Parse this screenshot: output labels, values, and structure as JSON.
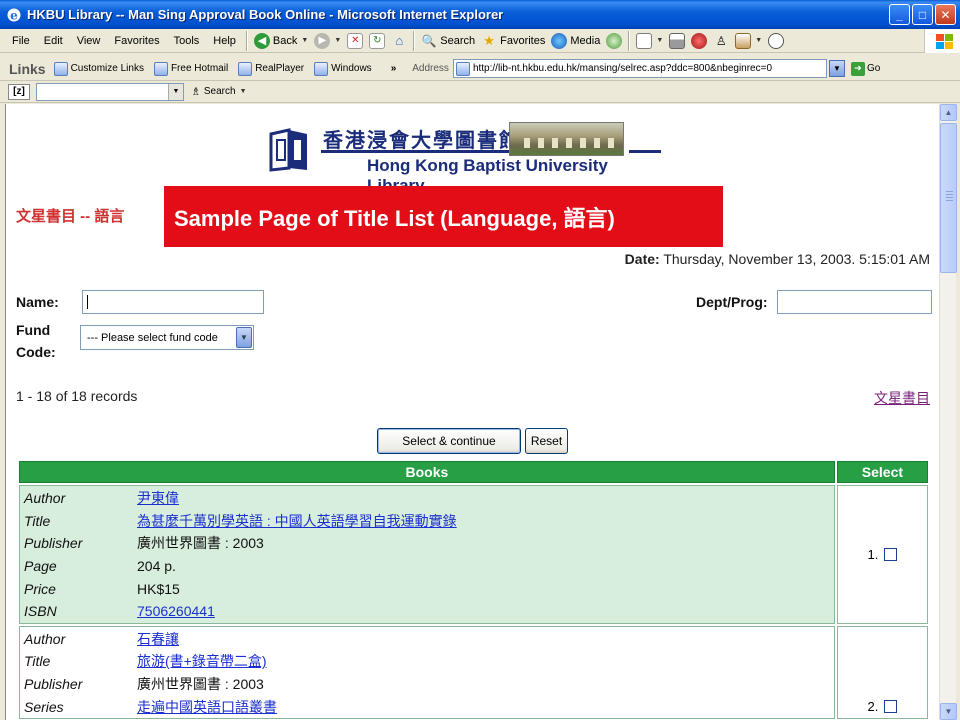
{
  "window": {
    "title": "HKBU Library -- Man Sing Approval Book Online - Microsoft Internet Explorer"
  },
  "menu": [
    "File",
    "Edit",
    "View",
    "Favorites",
    "Tools",
    "Help"
  ],
  "toolbar": {
    "back_label": "Back",
    "search_label": "Search",
    "favorites_label": "Favorites",
    "media_label": "Media"
  },
  "links_bar": {
    "label": "Links",
    "items": [
      "Customize Links",
      "Free Hotmail",
      "RealPlayer",
      "Windows"
    ],
    "address_label": "Address",
    "url": "http://lib-nt.hkbu.edu.hk/mansing/selrec.asp?ddc=800&nbeginrec=0",
    "go_label": "Go"
  },
  "search_bar": {
    "search_label": "Search"
  },
  "page": {
    "logo_zh": "香港浸會大學圖書館",
    "logo_en": "Hong Kong Baptist University Library",
    "section_title": "文星書目 -- 語言",
    "banner": "Sample Page of Title List (Language, 語言)",
    "date_label": "Date:",
    "date_value": "Thursday, November 13, 2003. 5:15:01 AM",
    "name_label": "Name:",
    "dept_label": "Dept/Prog:",
    "fund_label_1": "Fund",
    "fund_label_2": "Code:",
    "fund_selected": "--- Please select fund code",
    "records": "1 - 18 of 18 records",
    "top_link": "文星書目",
    "select_button": "Select & continue",
    "reset_button": "Reset",
    "table": {
      "col_books": "Books",
      "col_select": "Select",
      "rows": [
        {
          "num": "1.",
          "fields": [
            {
              "key": "Author",
              "value": "尹東偉",
              "link": true
            },
            {
              "key": "Title",
              "value": "為甚麼千萬別學英語 : 中國人英語學習自我運動實錄",
              "link": true
            },
            {
              "key": "Publisher",
              "value": "廣州世界圖書 : 2003",
              "link": false
            },
            {
              "key": "Page",
              "value": "204 p.",
              "link": false
            },
            {
              "key": "Price",
              "value": "HK$15",
              "link": false
            },
            {
              "key": "ISBN",
              "value": "7506260441",
              "link": true
            }
          ]
        },
        {
          "num": "2.",
          "fields": [
            {
              "key": "Author",
              "value": "石春讓",
              "link": true
            },
            {
              "key": "Title",
              "value": "旅游(書+錄音帶二盒)",
              "link": true
            },
            {
              "key": "Publisher",
              "value": "廣州世界圖書 : 2003",
              "link": false
            },
            {
              "key": "Series",
              "value": "走遍中國英語口語叢書",
              "link": true
            }
          ]
        }
      ]
    }
  }
}
